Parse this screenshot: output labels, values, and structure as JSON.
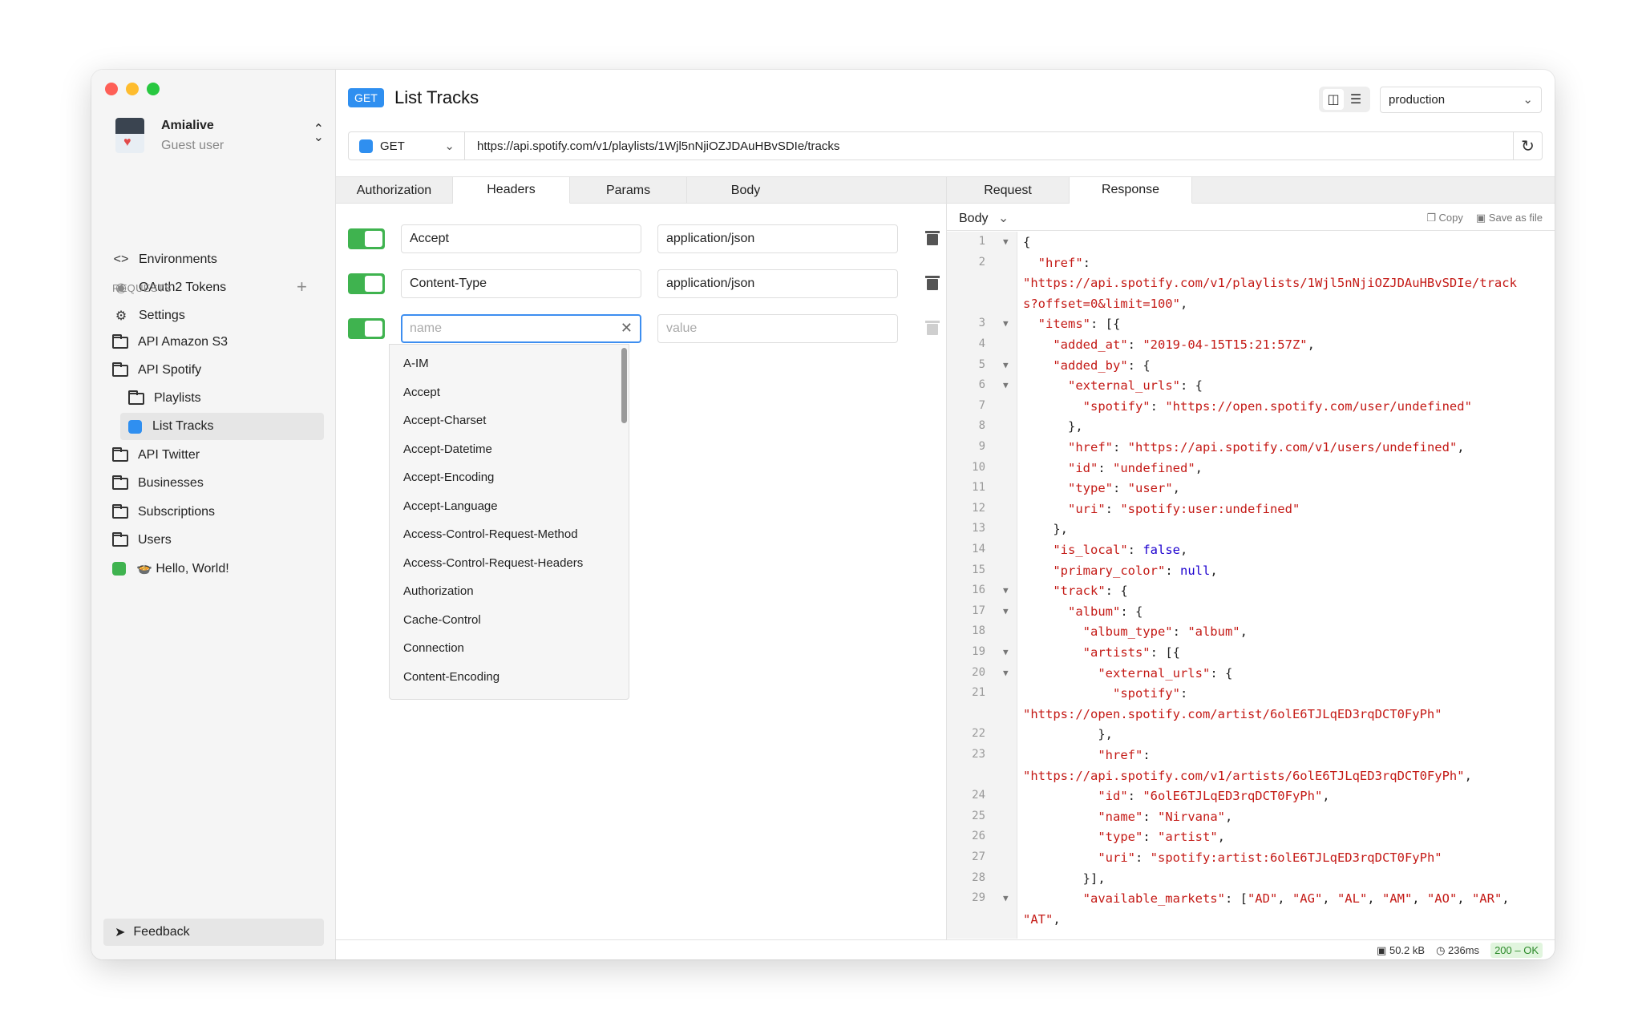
{
  "window": {
    "traffic_colors": [
      "#fe5f57",
      "#febc2e",
      "#28c840"
    ]
  },
  "user": {
    "name": "Amialive",
    "subtitle": "Guest user"
  },
  "nav": [
    {
      "label": "Environments",
      "icon": "code-brackets-icon"
    },
    {
      "label": "OAuth2 Tokens",
      "icon": "fingerprint-icon"
    },
    {
      "label": "Settings",
      "icon": "gear-icon"
    }
  ],
  "requests_section": {
    "label": "REQUESTS"
  },
  "tree": [
    {
      "label": "API Amazon S3",
      "kind": "folder"
    },
    {
      "label": "API Spotify",
      "kind": "folder"
    },
    {
      "label": "Playlists",
      "kind": "folder"
    },
    {
      "label": "List Tracks",
      "kind": "request",
      "color": "#2f8ff0",
      "active": true
    },
    {
      "label": "API Twitter",
      "kind": "folder"
    },
    {
      "label": "Businesses",
      "kind": "folder"
    },
    {
      "label": "Subscriptions",
      "kind": "folder"
    },
    {
      "label": "Users",
      "kind": "folder"
    },
    {
      "label": "🍲 Hello, World!",
      "kind": "request",
      "color": "#3fb34f"
    }
  ],
  "feedback_label": "Feedback",
  "request": {
    "method": "GET",
    "title": "List Tracks",
    "environment": "production",
    "url_method": "GET",
    "url": "https://api.spotify.com/v1/playlists/1Wjl5nNjiOZJDAuHBvSDIe/tracks"
  },
  "request_tabs": [
    "Authorization",
    "Headers",
    "Params",
    "Body"
  ],
  "response_tabs": [
    "Request",
    "Response"
  ],
  "headers": [
    {
      "name": "Accept",
      "value": "application/json",
      "enabled": true
    },
    {
      "name": "Content-Type",
      "value": "application/json",
      "enabled": true
    }
  ],
  "new_header": {
    "name_placeholder": "name",
    "value_placeholder": "value"
  },
  "suggestions": [
    "A-IM",
    "Accept",
    "Accept-Charset",
    "Accept-Datetime",
    "Accept-Encoding",
    "Accept-Language",
    "Access-Control-Request-Method",
    "Access-Control-Request-Headers",
    "Authorization",
    "Cache-Control",
    "Connection",
    "Content-Encoding"
  ],
  "response_body": {
    "label": "Body",
    "copy_label": "Copy",
    "save_label": "Save as file"
  },
  "code_lines": [
    {
      "n": "1",
      "fold": true,
      "html": "{"
    },
    {
      "n": "2",
      "fold": false,
      "html": "  <span class='str'>\"href\"</span>:"
    },
    {
      "n": "",
      "fold": false,
      "html": "<span class='str'>\"https://api.spotify.com/v1/playlists/1Wjl5nNjiOZJDAuHBvSDIe/track</span>"
    },
    {
      "n": "",
      "fold": false,
      "html": "<span class='str'>s?offset=0&amp;limit=100\"</span>,"
    },
    {
      "n": "3",
      "fold": true,
      "html": "  <span class='str'>\"items\"</span>: [{"
    },
    {
      "n": "4",
      "fold": false,
      "html": "    <span class='str'>\"added_at\"</span>: <span class='str'>\"2019-04-15T15:21:57Z\"</span>,"
    },
    {
      "n": "5",
      "fold": true,
      "html": "    <span class='str'>\"added_by\"</span>: {"
    },
    {
      "n": "6",
      "fold": true,
      "html": "      <span class='str'>\"external_urls\"</span>: {"
    },
    {
      "n": "7",
      "fold": false,
      "html": "        <span class='str'>\"spotify\"</span>: <span class='str'>\"https://open.spotify.com/user/undefined\"</span>"
    },
    {
      "n": "8",
      "fold": false,
      "html": "      },"
    },
    {
      "n": "9",
      "fold": false,
      "html": "      <span class='str'>\"href\"</span>: <span class='str'>\"https://api.spotify.com/v1/users/undefined\"</span>,"
    },
    {
      "n": "10",
      "fold": false,
      "html": "      <span class='str'>\"id\"</span>: <span class='str'>\"undefined\"</span>,"
    },
    {
      "n": "11",
      "fold": false,
      "html": "      <span class='str'>\"type\"</span>: <span class='str'>\"user\"</span>,"
    },
    {
      "n": "12",
      "fold": false,
      "html": "      <span class='str'>\"uri\"</span>: <span class='str'>\"spotify:user:undefined\"</span>"
    },
    {
      "n": "13",
      "fold": false,
      "html": "    },"
    },
    {
      "n": "14",
      "fold": false,
      "html": "    <span class='str'>\"is_local\"</span>: <span class='kw'>false</span>,"
    },
    {
      "n": "15",
      "fold": false,
      "html": "    <span class='str'>\"primary_color\"</span>: <span class='kw'>null</span>,"
    },
    {
      "n": "16",
      "fold": true,
      "html": "    <span class='str'>\"track\"</span>: {"
    },
    {
      "n": "17",
      "fold": true,
      "html": "      <span class='str'>\"album\"</span>: {"
    },
    {
      "n": "18",
      "fold": false,
      "html": "        <span class='str'>\"album_type\"</span>: <span class='str'>\"album\"</span>,"
    },
    {
      "n": "19",
      "fold": true,
      "html": "        <span class='str'>\"artists\"</span>: [{"
    },
    {
      "n": "20",
      "fold": true,
      "html": "          <span class='str'>\"external_urls\"</span>: {"
    },
    {
      "n": "21",
      "fold": false,
      "html": "            <span class='str'>\"spotify\"</span>:"
    },
    {
      "n": "",
      "fold": false,
      "html": "<span class='str'>\"https://open.spotify.com/artist/6olE6TJLqED3rqDCT0FyPh\"</span>"
    },
    {
      "n": "22",
      "fold": false,
      "html": "          },"
    },
    {
      "n": "23",
      "fold": false,
      "html": "          <span class='str'>\"href\"</span>:"
    },
    {
      "n": "",
      "fold": false,
      "html": "<span class='str'>\"https://api.spotify.com/v1/artists/6olE6TJLqED3rqDCT0FyPh\"</span>,"
    },
    {
      "n": "24",
      "fold": false,
      "html": "          <span class='str'>\"id\"</span>: <span class='str'>\"6olE6TJLqED3rqDCT0FyPh\"</span>,"
    },
    {
      "n": "25",
      "fold": false,
      "html": "          <span class='str'>\"name\"</span>: <span class='str'>\"Nirvana\"</span>,"
    },
    {
      "n": "26",
      "fold": false,
      "html": "          <span class='str'>\"type\"</span>: <span class='str'>\"artist\"</span>,"
    },
    {
      "n": "27",
      "fold": false,
      "html": "          <span class='str'>\"uri\"</span>: <span class='str'>\"spotify:artist:6olE6TJLqED3rqDCT0FyPh\"</span>"
    },
    {
      "n": "28",
      "fold": false,
      "html": "        }],"
    },
    {
      "n": "29",
      "fold": true,
      "html": "        <span class='str'>\"available_markets\"</span>: [<span class='str'>\"AD\"</span>, <span class='str'>\"AG\"</span>, <span class='str'>\"AL\"</span>, <span class='str'>\"AM\"</span>, <span class='str'>\"AO\"</span>, <span class='str'>\"AR\"</span>,"
    },
    {
      "n": "",
      "fold": false,
      "html": "<span class='str'>\"AT\"</span>,"
    }
  ],
  "status": {
    "size": "50.2 kB",
    "time": "236ms",
    "code": "200 – OK"
  }
}
